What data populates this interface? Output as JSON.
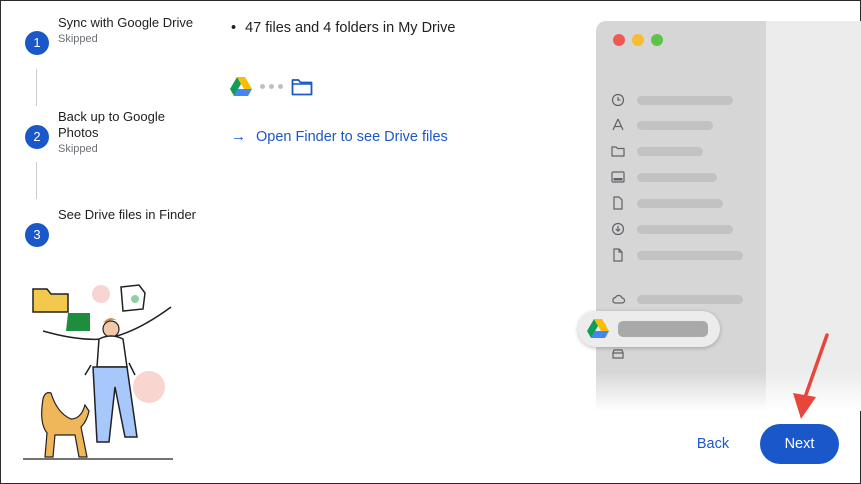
{
  "steps": [
    {
      "number": "1",
      "title": "Sync with Google Drive",
      "status": "Skipped"
    },
    {
      "number": "2",
      "title": "Back up to Google Photos",
      "status": "Skipped"
    },
    {
      "number": "3",
      "title": "See Drive files in Finder",
      "status": ""
    }
  ],
  "main": {
    "bullet": "47 files and 4 folders in My Drive",
    "open_link": "Open Finder to see Drive files",
    "icons": [
      "google-drive-icon",
      "dots-icon",
      "folder-icon",
      "arrow-right-icon"
    ]
  },
  "finder_mock": {
    "sidebar_icons": [
      "clock-icon",
      "apps-icon",
      "folder-icon",
      "desktop-icon",
      "document-icon",
      "download-icon",
      "file-icon",
      "cloud-icon",
      "google-drive-icon",
      "disk-icon"
    ]
  },
  "buttons": {
    "back": "Back",
    "next": "Next"
  },
  "colors": {
    "accent": "#1a57c9",
    "annotation_arrow": "#e8453c"
  }
}
